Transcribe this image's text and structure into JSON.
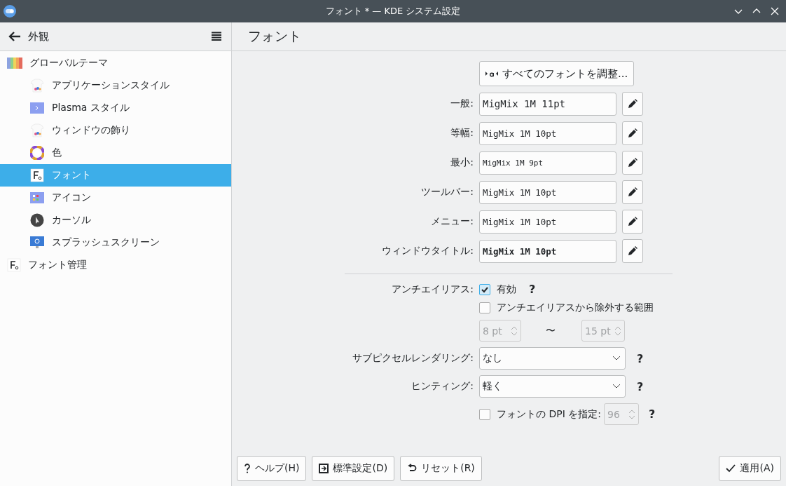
{
  "window": {
    "title": "フォント * — KDE システム設定"
  },
  "sidebar": {
    "back_label": "外観",
    "items": [
      {
        "label": "グローバルテーマ",
        "kind": "theme",
        "selected": false,
        "children": [
          {
            "label": "アプリケーションスタイル",
            "kind": "shirt",
            "selected": false
          },
          {
            "label": "Plasma スタイル",
            "kind": "desktop",
            "selected": false
          },
          {
            "label": "ウィンドウの飾り",
            "kind": "shirt",
            "selected": false
          },
          {
            "label": "色",
            "kind": "wheel",
            "selected": false
          },
          {
            "label": "フォント",
            "kind": "font",
            "selected": true
          },
          {
            "label": "アイコン",
            "kind": "grid",
            "selected": false
          },
          {
            "label": "カーソル",
            "kind": "cursor",
            "selected": false
          },
          {
            "label": "スプラッシュスクリーン",
            "kind": "monitor",
            "selected": false
          }
        ]
      },
      {
        "label": "フォント管理",
        "kind": "font",
        "selected": false
      }
    ]
  },
  "page": {
    "title": "フォント",
    "adjust_button": "すべてのフォントを調整...",
    "fonts": [
      {
        "label": "一般:",
        "value": "MigMix 1M 11pt",
        "kind": "large"
      },
      {
        "label": "等幅:",
        "value": "MigMix 1M 10pt",
        "kind": "medium"
      },
      {
        "label": "最小:",
        "value": "MigMix 1M 9pt",
        "kind": "small"
      },
      {
        "label": "ツールバー:",
        "value": "MigMix 1M 10pt",
        "kind": "medium"
      },
      {
        "label": "メニュー:",
        "value": "MigMix 1M 10pt",
        "kind": "medium"
      },
      {
        "label": "ウィンドウタイトル:",
        "value": "MigMix 1M 10pt",
        "kind": "bold"
      }
    ],
    "antialiasing": {
      "label": "アンチエイリアス:",
      "option": "有効",
      "checked": true,
      "help": "?"
    },
    "exclude": {
      "label": "アンチエイリアスから除外する範囲",
      "checked": false,
      "from": "8 pt",
      "separator": "〜",
      "to": "15 pt"
    },
    "subpixel": {
      "label": "サブピクセルレンダリング:",
      "value": "なし",
      "help": "?"
    },
    "hinting": {
      "label": "ヒンティング:",
      "value": "軽く",
      "help": "?"
    },
    "dpi": {
      "label": "フォントの DPI を指定:",
      "checked": false,
      "value": "96",
      "help": "?"
    }
  },
  "buttons": [
    {
      "label": "ヘルプ(H)",
      "kind": "help"
    },
    {
      "label": "標準設定(D)",
      "kind": "defaults"
    },
    {
      "label": "リセット(R)",
      "kind": "reset"
    }
  ],
  "apply_button": {
    "label": "適用(A)"
  }
}
